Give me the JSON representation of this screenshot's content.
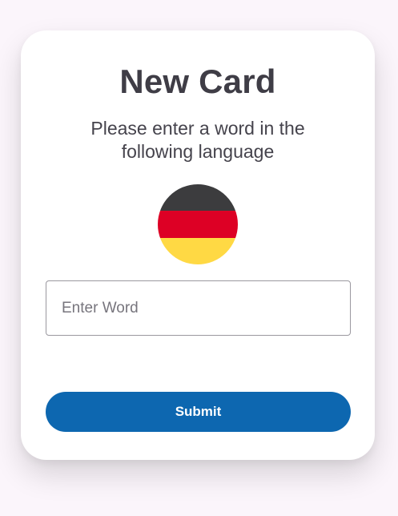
{
  "card": {
    "title": "New Card",
    "instructions": "Please enter a word in the following language"
  },
  "language_flag": {
    "icon": "germany-flag-icon",
    "stripes": [
      "#3c3c3e",
      "#dd0025",
      "#ffd944"
    ]
  },
  "word_input": {
    "placeholder": "Enter Word",
    "value": ""
  },
  "submit_button": {
    "label": "Submit",
    "color": "#0d67b0"
  },
  "colors": {
    "background": "#fbf5fb",
    "card": "#ffffff",
    "text": "#3f3d46"
  }
}
